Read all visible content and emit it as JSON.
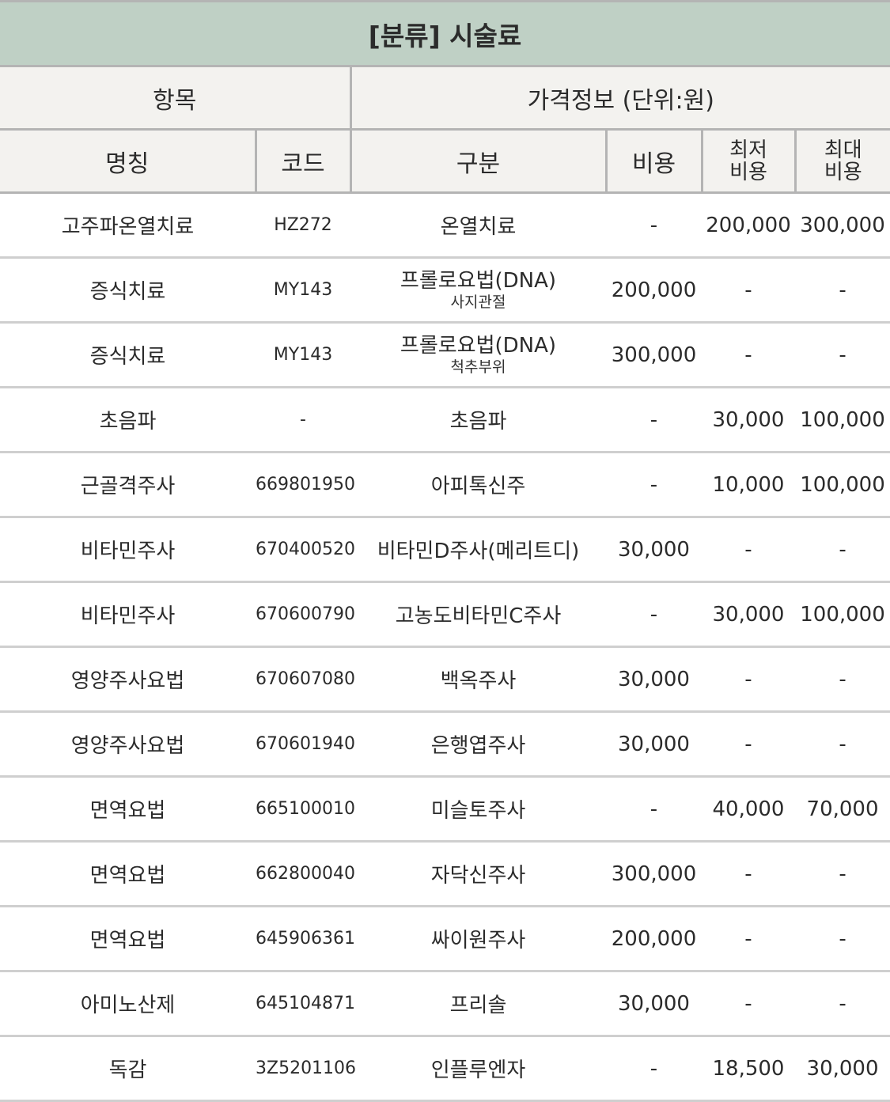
{
  "title": "[분류] 시술료",
  "group_headers": {
    "item": "항목",
    "price_info": "가격정보 (단위:원)"
  },
  "columns": {
    "name": "명칭",
    "code": "코드",
    "category": "구분",
    "cost": "비용",
    "min_cost_line1": "최저",
    "min_cost_line2": "비용",
    "max_cost_line1": "최대",
    "max_cost_line2": "비용"
  },
  "rows": [
    {
      "name": "고주파온열치료",
      "code": "HZ272",
      "category": "온열치료",
      "sub": "",
      "cost": "-",
      "min": "200,000",
      "max": "300,000"
    },
    {
      "name": "증식치료",
      "code": "MY143",
      "category": "프롤로요법(DNA)",
      "sub": "사지관절",
      "cost": "200,000",
      "min": "-",
      "max": "-"
    },
    {
      "name": "증식치료",
      "code": "MY143",
      "category": "프롤로요법(DNA)",
      "sub": "척추부위",
      "cost": "300,000",
      "min": "-",
      "max": "-"
    },
    {
      "name": "초음파",
      "code": "-",
      "category": "초음파",
      "sub": "",
      "cost": "-",
      "min": "30,000",
      "max": "100,000"
    },
    {
      "name": "근골격주사",
      "code": "669801950",
      "category": "아피톡신주",
      "sub": "",
      "cost": "-",
      "min": "10,000",
      "max": "100,000"
    },
    {
      "name": "비타민주사",
      "code": "670400520",
      "category": "비타민D주사(메리트디)",
      "sub": "",
      "cost": "30,000",
      "min": "-",
      "max": "-"
    },
    {
      "name": "비타민주사",
      "code": "670600790",
      "category": "고농도비타민C주사",
      "sub": "",
      "cost": "-",
      "min": "30,000",
      "max": "100,000"
    },
    {
      "name": "영양주사요법",
      "code": "670607080",
      "category": "백옥주사",
      "sub": "",
      "cost": "30,000",
      "min": "-",
      "max": "-"
    },
    {
      "name": "영양주사요법",
      "code": "670601940",
      "category": "은행엽주사",
      "sub": "",
      "cost": "30,000",
      "min": "-",
      "max": "-"
    },
    {
      "name": "면역요법",
      "code": "665100010",
      "category": "미슬토주사",
      "sub": "",
      "cost": "-",
      "min": "40,000",
      "max": "70,000"
    },
    {
      "name": "면역요법",
      "code": "662800040",
      "category": "자닥신주사",
      "sub": "",
      "cost": "300,000",
      "min": "-",
      "max": "-"
    },
    {
      "name": "면역요법",
      "code": "645906361",
      "category": "싸이원주사",
      "sub": "",
      "cost": "200,000",
      "min": "-",
      "max": "-"
    },
    {
      "name": "아미노산제",
      "code": "645104871",
      "category": "프리솔",
      "sub": "",
      "cost": "30,000",
      "min": "-",
      "max": "-"
    },
    {
      "name": "독감",
      "code": "3Z5201106",
      "category": "인플루엔자",
      "sub": "",
      "cost": "-",
      "min": "18,500",
      "max": "30,000"
    }
  ]
}
